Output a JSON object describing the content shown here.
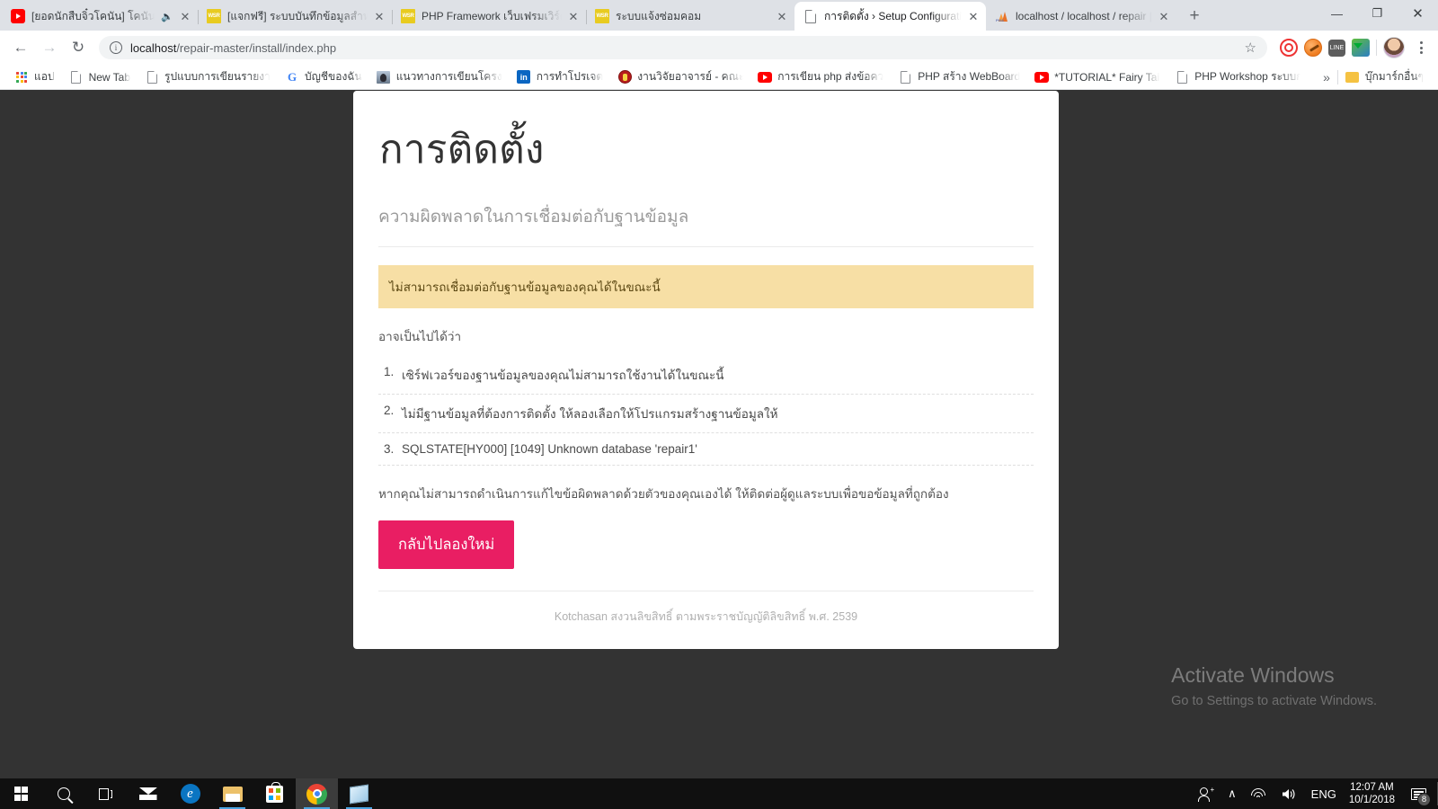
{
  "browser": {
    "tabs": [
      {
        "title": "[ยอดนักสืบจิ๋วโคนัน] โคนันเฉลย",
        "favicon": "youtube-icon",
        "audio": true,
        "active": false
      },
      {
        "title": "[แจกฟรี] ระบบบันทึกข้อมูลสำหรับร้า",
        "favicon": "wsr-icon",
        "audio": false,
        "active": false
      },
      {
        "title": "PHP Framework เว็บเฟรมเวิร์ด โด",
        "favicon": "wsr-icon",
        "audio": false,
        "active": false
      },
      {
        "title": "ระบบแจ้งซ่อมคอม",
        "favicon": "wsr-icon",
        "audio": false,
        "active": false
      },
      {
        "title": "การติดตั้ง › Setup Configuration",
        "favicon": "page-icon",
        "audio": false,
        "active": true
      },
      {
        "title": "localhost / localhost / repair | p",
        "favicon": "phpmyadmin-icon",
        "audio": false,
        "active": false
      }
    ],
    "new_tab_label": "+",
    "window_controls": {
      "minimize": "—",
      "maximize": "❐",
      "close": "✕"
    },
    "nav": {
      "back": "←",
      "forward": "→",
      "reload": "↻"
    },
    "omnibox": {
      "info_icon_label": "i",
      "url_host": "localhost",
      "url_path": "/repair-master/install/index.php",
      "full_url": "localhost/repair-master/install/index.php"
    },
    "star_icon": "☆",
    "extensions": [
      "opera-vpn-icon",
      "hammer-extension-icon",
      "line-icon",
      "idm-icon"
    ],
    "menu_label": "⋮",
    "bookmarks": [
      {
        "label": "แอป",
        "icon": "apps-grid-icon"
      },
      {
        "label": "New Tab",
        "icon": "page-icon"
      },
      {
        "label": "รูปแบบการเขียนรายงาน",
        "icon": "page-icon"
      },
      {
        "label": "บัญชีของฉัน",
        "icon": "google-icon"
      },
      {
        "label": "แนวทางการเขียนโครงงาน",
        "icon": "photo-icon"
      },
      {
        "label": "การทำโปรเจต",
        "icon": "linkedin-icon"
      },
      {
        "label": "งานวิจัยอาจารย์ - คณะวิ",
        "icon": "seal-icon"
      },
      {
        "label": "การเขียน php ส่งข้อความ",
        "icon": "youtube-icon"
      },
      {
        "label": "PHP สร้าง WebBoard",
        "icon": "page-icon"
      },
      {
        "label": "*TUTORIAL* Fairy Tail",
        "icon": "youtube-icon"
      },
      {
        "label": "PHP Workshop ระบบก",
        "icon": "page-icon"
      }
    ],
    "bookmarks_overflow": "»",
    "other_bookmarks": {
      "label": "บุ๊กมาร์กอื่นๆ",
      "icon": "folder-icon"
    }
  },
  "page": {
    "title": "การติดตั้ง",
    "subtitle": "ความผิดพลาดในการเชื่อมต่อกับฐานข้อมูล",
    "alert": "ไม่สามารถเชื่อมต่อกับฐานข้อมูลของคุณได้ในขณะนี้",
    "lead": "อาจเป็นไปได้ว่า",
    "reasons": [
      "เซิร์ฟเวอร์ของฐานข้อมูลของคุณไม่สามารถใช้งานได้ในขณะนี้",
      "ไม่มีฐานข้อมูลที่ต้องการติดตั้ง ให้ลองเลือกให้โปรแกรมสร้างฐานข้อมูลให้",
      "SQLSTATE[HY000] [1049] Unknown database 'repair1'"
    ],
    "note": "หากคุณไม่สามารถดำเนินการแก้ไขข้อผิดพลาดด้วยตัวของคุณเองได้ ให้ติดต่อผู้ดูแลระบบเพื่อขอข้อมูลที่ถูกต้อง",
    "retry_button": "กลับไปลองใหม่",
    "footer": "Kotchasan สงวนลิขสิทธิ์ ตามพระราชบัญญัติลิขสิทธิ์ พ.ศ. 2539",
    "accent_color": "#e91e63",
    "alert_color": "#f7dfa5",
    "background_color": "#333333"
  },
  "watermark": {
    "line1": "Activate Windows",
    "line2": "Go to Settings to activate Windows."
  },
  "taskbar": {
    "items": [
      "start-icon",
      "search-icon",
      "task-view-icon",
      "mail-icon",
      "edge-icon",
      "file-explorer-icon",
      "microsoft-store-icon",
      "chrome-icon",
      "sticky-notes-icon"
    ],
    "tray": {
      "people_label": "",
      "chevron": "∧",
      "language": "ENG",
      "time": "12:07 AM",
      "date": "10/1/2018",
      "notification_count": "8"
    }
  }
}
